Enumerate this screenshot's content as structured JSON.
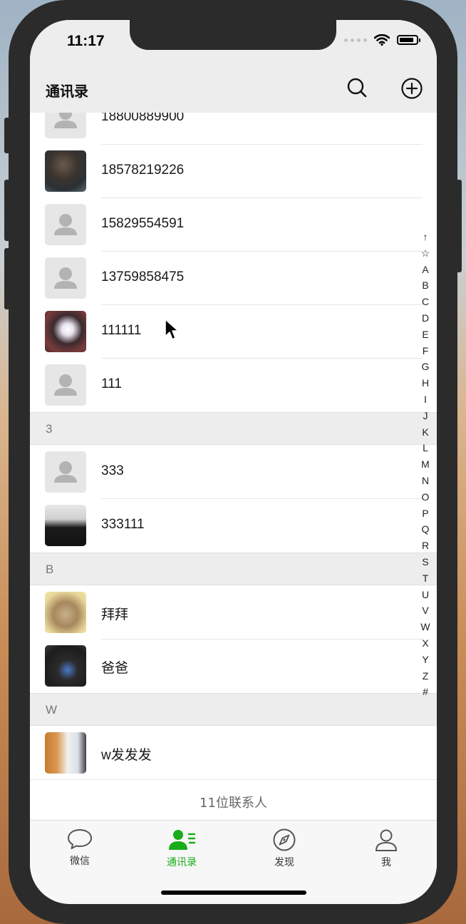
{
  "status_bar": {
    "time": "11:17"
  },
  "nav": {
    "title": "通讯录",
    "search_icon": "search-icon",
    "add_icon": "add-circle-icon"
  },
  "contacts": [
    {
      "name": "18800889900",
      "avatar": "default-avatar"
    },
    {
      "name": "18578219226",
      "avatar": "photo"
    },
    {
      "name": "15829554591",
      "avatar": "default-avatar"
    },
    {
      "name": "13759858475",
      "avatar": "default-avatar"
    },
    {
      "name": "111111",
      "avatar": "photo"
    },
    {
      "name": "111",
      "avatar": "default-avatar"
    }
  ],
  "sections": [
    {
      "letter": "3",
      "contacts": [
        {
          "name": "333",
          "avatar": "default-avatar"
        },
        {
          "name": "333111",
          "avatar": "photo"
        }
      ]
    },
    {
      "letter": "B",
      "contacts": [
        {
          "name": "拜拜",
          "avatar": "photo"
        },
        {
          "name": "爸爸",
          "avatar": "photo"
        }
      ]
    },
    {
      "letter": "W",
      "contacts": [
        {
          "name": "w发发发",
          "avatar": "photo"
        }
      ]
    }
  ],
  "footer": {
    "count_text": "11位联系人"
  },
  "index_bar": [
    "↑",
    "☆",
    "A",
    "B",
    "C",
    "D",
    "E",
    "F",
    "G",
    "H",
    "I",
    "J",
    "K",
    "L",
    "M",
    "N",
    "O",
    "P",
    "Q",
    "R",
    "S",
    "T",
    "U",
    "V",
    "W",
    "X",
    "Y",
    "Z",
    "#"
  ],
  "tabbar": {
    "tabs": [
      {
        "label": "微信",
        "icon": "chat-bubble-icon",
        "active": false
      },
      {
        "label": "通讯录",
        "icon": "contacts-icon",
        "active": true
      },
      {
        "label": "发现",
        "icon": "compass-icon",
        "active": false
      },
      {
        "label": "我",
        "icon": "person-icon",
        "active": false
      }
    ]
  },
  "colors": {
    "accent": "#1aad19",
    "nav_bg": "#ededed",
    "section_bg": "#ededed"
  }
}
